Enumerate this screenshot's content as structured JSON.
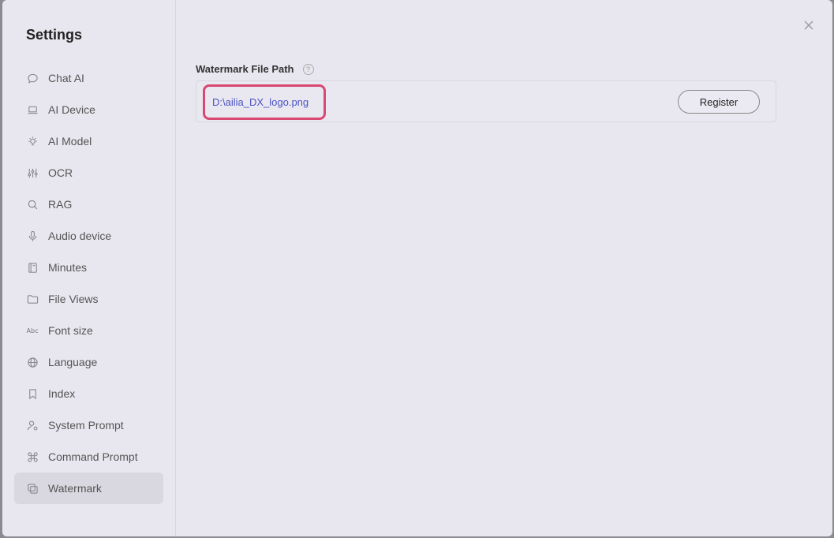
{
  "sidebar": {
    "title": "Settings",
    "items": [
      {
        "label": "Chat AI",
        "icon": "chat-bubble-icon"
      },
      {
        "label": "AI Device",
        "icon": "laptop-icon"
      },
      {
        "label": "AI Model",
        "icon": "lightbulb-icon"
      },
      {
        "label": "OCR",
        "icon": "sliders-icon"
      },
      {
        "label": "RAG",
        "icon": "search-icon"
      },
      {
        "label": "Audio device",
        "icon": "microphone-icon"
      },
      {
        "label": "Minutes",
        "icon": "notebook-icon"
      },
      {
        "label": "File Views",
        "icon": "folder-icon"
      },
      {
        "label": "Font size",
        "icon": "abc-icon",
        "icon_text": "Abc"
      },
      {
        "label": "Language",
        "icon": "globe-icon"
      },
      {
        "label": "Index",
        "icon": "bookmark-icon"
      },
      {
        "label": "System Prompt",
        "icon": "user-gear-icon"
      },
      {
        "label": "Command Prompt",
        "icon": "command-icon"
      },
      {
        "label": "Watermark",
        "icon": "copy-icon",
        "active": true
      }
    ]
  },
  "main": {
    "section_label": "Watermark File Path",
    "help_glyph": "?",
    "file_path": "D:\\ailia_DX_logo.png",
    "register_label": "Register"
  },
  "colors": {
    "highlight": "#d94873",
    "link": "#4b53c4"
  }
}
